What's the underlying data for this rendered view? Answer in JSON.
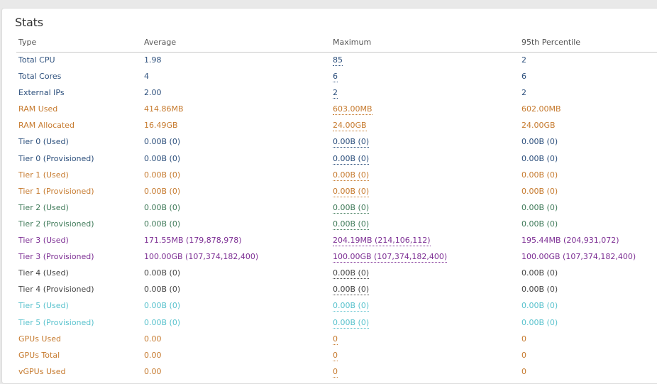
{
  "panel": {
    "title": "Stats",
    "columns": [
      "Type",
      "Average",
      "Maximum",
      "95th Percentile"
    ]
  },
  "colors": {
    "navy": "#2c4f7c",
    "orange": "#c67a2e",
    "green": "#3f7a59",
    "purple": "#7d2f94",
    "dark": "#444444",
    "cyan": "#59c2cd"
  },
  "rows": [
    {
      "type": "Total CPU",
      "average": "1.98",
      "maximum": "85",
      "p95": "2",
      "color": "navy"
    },
    {
      "type": "Total Cores",
      "average": "4",
      "maximum": "6",
      "p95": "6",
      "color": "navy"
    },
    {
      "type": "External IPs",
      "average": "2.00",
      "maximum": "2",
      "p95": "2",
      "color": "navy"
    },
    {
      "type": "RAM Used",
      "average": "414.86MB",
      "maximum": "603.00MB",
      "p95": "602.00MB",
      "color": "orange"
    },
    {
      "type": "RAM Allocated",
      "average": "16.49GB",
      "maximum": "24.00GB",
      "p95": "24.00GB",
      "color": "orange"
    },
    {
      "type": "Tier 0 (Used)",
      "average": "0.00B (0)",
      "maximum": "0.00B (0)",
      "p95": "0.00B (0)",
      "color": "navy"
    },
    {
      "type": "Tier 0 (Provisioned)",
      "average": "0.00B (0)",
      "maximum": "0.00B (0)",
      "p95": "0.00B (0)",
      "color": "navy"
    },
    {
      "type": "Tier 1 (Used)",
      "average": "0.00B (0)",
      "maximum": "0.00B (0)",
      "p95": "0.00B (0)",
      "color": "orange"
    },
    {
      "type": "Tier 1 (Provisioned)",
      "average": "0.00B (0)",
      "maximum": "0.00B (0)",
      "p95": "0.00B (0)",
      "color": "orange"
    },
    {
      "type": "Tier 2 (Used)",
      "average": "0.00B (0)",
      "maximum": "0.00B (0)",
      "p95": "0.00B (0)",
      "color": "green"
    },
    {
      "type": "Tier 2 (Provisioned)",
      "average": "0.00B (0)",
      "maximum": "0.00B (0)",
      "p95": "0.00B (0)",
      "color": "green"
    },
    {
      "type": "Tier 3 (Used)",
      "average": "171.55MB (179,878,978)",
      "maximum": "204.19MB (214,106,112)",
      "p95": "195.44MB (204,931,072)",
      "color": "purple"
    },
    {
      "type": "Tier 3 (Provisioned)",
      "average": "100.00GB (107,374,182,400)",
      "maximum": "100.00GB (107,374,182,400)",
      "p95": "100.00GB (107,374,182,400)",
      "color": "purple"
    },
    {
      "type": "Tier 4 (Used)",
      "average": "0.00B (0)",
      "maximum": "0.00B (0)",
      "p95": "0.00B (0)",
      "color": "dark"
    },
    {
      "type": "Tier 4 (Provisioned)",
      "average": "0.00B (0)",
      "maximum": "0.00B (0)",
      "p95": "0.00B (0)",
      "color": "dark"
    },
    {
      "type": "Tier 5 (Used)",
      "average": "0.00B (0)",
      "maximum": "0.00B (0)",
      "p95": "0.00B (0)",
      "color": "cyan"
    },
    {
      "type": "Tier 5 (Provisioned)",
      "average": "0.00B (0)",
      "maximum": "0.00B (0)",
      "p95": "0.00B (0)",
      "color": "cyan"
    },
    {
      "type": "GPUs Used",
      "average": "0.00",
      "maximum": "0",
      "p95": "0",
      "color": "orange"
    },
    {
      "type": "GPUs Total",
      "average": "0.00",
      "maximum": "0",
      "p95": "0",
      "color": "orange"
    },
    {
      "type": "vGPUs Used",
      "average": "0.00",
      "maximum": "0",
      "p95": "0",
      "color": "orange"
    }
  ]
}
